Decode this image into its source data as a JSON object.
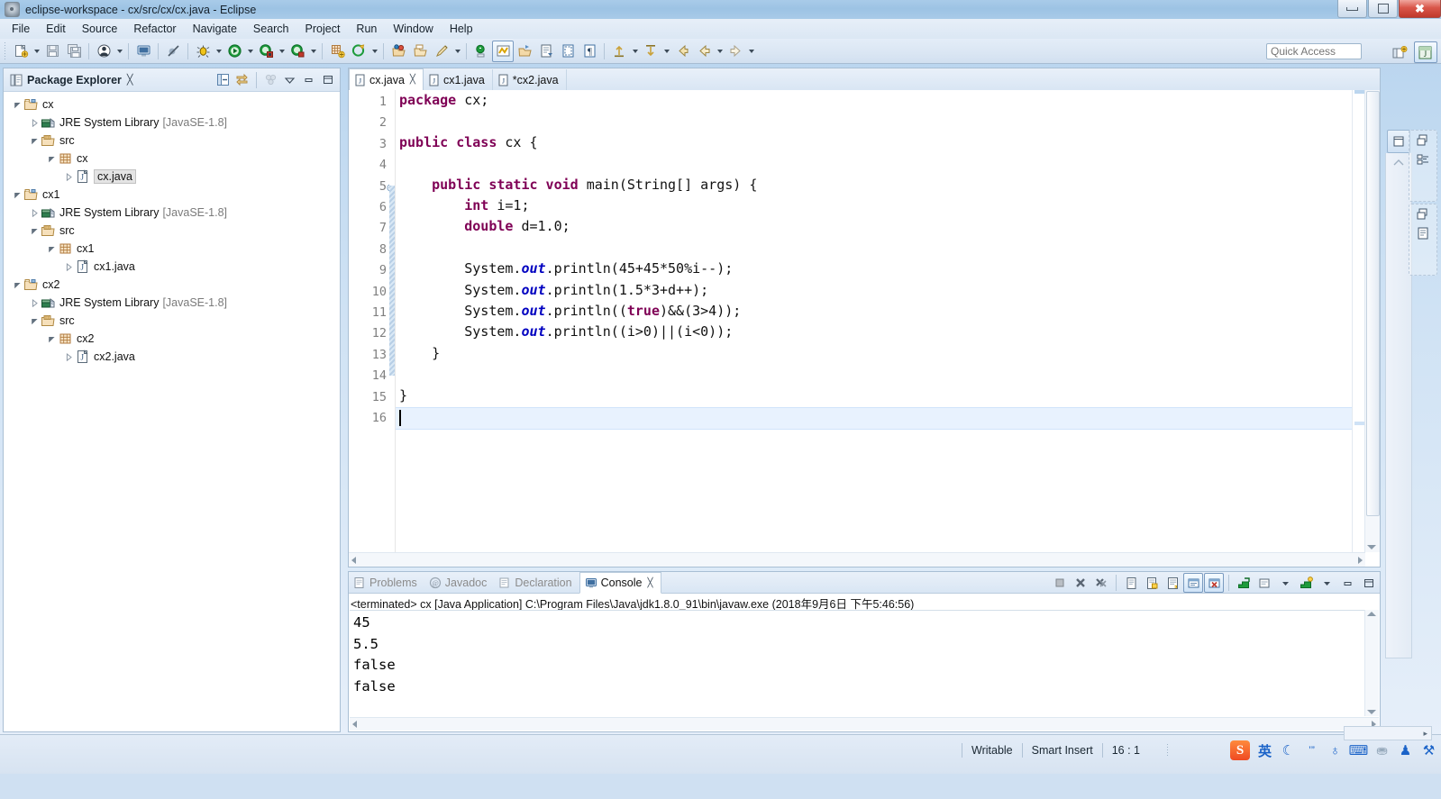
{
  "window": {
    "title": "eclipse-workspace - cx/src/cx/cx.java - Eclipse",
    "app_icon": "eclipse-icon",
    "minimize_label": "Minimize",
    "maximize_label": "Restore",
    "close_label": "Close"
  },
  "menu": {
    "items": [
      {
        "label": "File"
      },
      {
        "label": "Edit"
      },
      {
        "label": "Source"
      },
      {
        "label": "Refactor"
      },
      {
        "label": "Navigate"
      },
      {
        "label": "Search"
      },
      {
        "label": "Project"
      },
      {
        "label": "Run"
      },
      {
        "label": "Window"
      },
      {
        "label": "Help"
      }
    ]
  },
  "toolbar": {
    "quick_access_placeholder": "Quick Access",
    "quick_access_value": "",
    "buttons": [
      {
        "name": "new-wizard",
        "icon": "new-file-icon"
      },
      {
        "name": "save",
        "icon": "save-icon"
      },
      {
        "name": "save-all",
        "icon": "save-all-icon"
      },
      {
        "name": "toggle-breadcrumb",
        "icon": "person-icon"
      },
      {
        "name": "new-java-console",
        "icon": "console-icon"
      },
      {
        "name": "skip-breakpoints",
        "icon": "skip-breakpoints-icon"
      },
      {
        "name": "debug",
        "icon": "debug-bug-icon"
      },
      {
        "name": "run",
        "icon": "run-green-play-icon"
      },
      {
        "name": "coverage",
        "icon": "coverage-icon"
      },
      {
        "name": "run-last-tool",
        "icon": "external-tools-icon"
      },
      {
        "name": "new-java-project",
        "icon": "new-java-project-icon"
      },
      {
        "name": "new-package",
        "icon": "new-package-icon"
      },
      {
        "name": "open-type",
        "icon": "open-type-icon"
      },
      {
        "name": "open-task",
        "icon": "open-task-icon"
      },
      {
        "name": "search",
        "icon": "search-pencil-icon"
      },
      {
        "name": "next-annotation",
        "icon": "next-annotation-icon"
      },
      {
        "name": "toggle-mark-occurrences",
        "icon": "mark-occurrences-icon"
      },
      {
        "name": "restore-last-selection",
        "icon": "restore-selection-icon"
      },
      {
        "name": "open-task-editor",
        "icon": "task-editor-icon"
      },
      {
        "name": "toggle-block-selection",
        "icon": "block-selection-icon"
      },
      {
        "name": "show-whitespace",
        "icon": "pilcrow-icon"
      },
      {
        "name": "previous-edit-location",
        "icon": "prev-edit-icon"
      },
      {
        "name": "next-edit-location",
        "icon": "next-edit-icon"
      },
      {
        "name": "back",
        "icon": "back-arrow-icon"
      },
      {
        "name": "forward",
        "icon": "forward-arrow-icon"
      }
    ],
    "perspective_buttons": [
      {
        "name": "open-perspective",
        "icon": "open-perspective-icon"
      },
      {
        "name": "java-perspective",
        "icon": "java-perspective-icon",
        "active": true
      }
    ]
  },
  "package_explorer": {
    "title": "Package Explorer",
    "close_glyph": "╳",
    "toolbar": [
      {
        "name": "collapse-all",
        "icon": "collapse-all-icon"
      },
      {
        "name": "link-with-editor",
        "icon": "link-editor-icon"
      },
      {
        "name": "focus-on-active-task",
        "icon": "focus-task-icon"
      },
      {
        "name": "view-menu",
        "icon": "view-menu-icon"
      },
      {
        "name": "minimize-view",
        "icon": "minimize-icon"
      },
      {
        "name": "maximize-view",
        "icon": "maximize-icon"
      }
    ],
    "tree": [
      {
        "label": "cx",
        "sub": "",
        "icon": "java-project-icon",
        "indent": 0,
        "state": "expanded",
        "selected": false
      },
      {
        "label": "JRE System Library",
        "sub": "[JavaSE-1.8]",
        "icon": "library-icon",
        "indent": 1,
        "state": "collapsed",
        "selected": false
      },
      {
        "label": "src",
        "sub": "",
        "icon": "source-folder-icon",
        "indent": 1,
        "state": "expanded",
        "selected": false
      },
      {
        "label": "cx",
        "sub": "",
        "icon": "package-icon",
        "indent": 2,
        "state": "expanded",
        "selected": false
      },
      {
        "label": "cx.java",
        "sub": "",
        "icon": "java-file-icon",
        "indent": 3,
        "state": "collapsed",
        "selected": true
      },
      {
        "label": "cx1",
        "sub": "",
        "icon": "java-project-icon",
        "indent": 0,
        "state": "expanded",
        "selected": false
      },
      {
        "label": "JRE System Library",
        "sub": "[JavaSE-1.8]",
        "icon": "library-icon",
        "indent": 1,
        "state": "collapsed",
        "selected": false
      },
      {
        "label": "src",
        "sub": "",
        "icon": "source-folder-icon",
        "indent": 1,
        "state": "expanded",
        "selected": false
      },
      {
        "label": "cx1",
        "sub": "",
        "icon": "package-icon",
        "indent": 2,
        "state": "expanded",
        "selected": false
      },
      {
        "label": "cx1.java",
        "sub": "",
        "icon": "java-file-icon",
        "indent": 3,
        "state": "collapsed",
        "selected": false
      },
      {
        "label": "cx2",
        "sub": "",
        "icon": "java-project-icon",
        "indent": 0,
        "state": "expanded",
        "selected": false
      },
      {
        "label": "JRE System Library",
        "sub": "[JavaSE-1.8]",
        "icon": "library-icon",
        "indent": 1,
        "state": "collapsed",
        "selected": false
      },
      {
        "label": "src",
        "sub": "",
        "icon": "source-folder-icon",
        "indent": 1,
        "state": "expanded",
        "selected": false
      },
      {
        "label": "cx2",
        "sub": "",
        "icon": "package-icon",
        "indent": 2,
        "state": "expanded",
        "selected": false
      },
      {
        "label": "cx2.java",
        "sub": "",
        "icon": "java-file-icon",
        "indent": 3,
        "state": "collapsed",
        "selected": false
      }
    ]
  },
  "editor": {
    "tabs": [
      {
        "label": "cx.java",
        "active": true,
        "dirty": false,
        "close_glyph": "╳"
      },
      {
        "label": "cx1.java",
        "active": false,
        "dirty": false,
        "close_glyph": ""
      },
      {
        "label": "*cx2.java",
        "active": false,
        "dirty": true,
        "close_glyph": ""
      }
    ],
    "line_numbers": [
      "1",
      "2",
      "3",
      "4",
      "5",
      "6",
      "7",
      "8",
      "9",
      "10",
      "11",
      "12",
      "13",
      "14",
      "15",
      "16"
    ],
    "current_line": 16,
    "fold_marker_line": 5,
    "lines": [
      {
        "n": 1,
        "tokens": [
          {
            "t": "package",
            "c": "kw"
          },
          {
            "t": " cx;",
            "c": "pl"
          }
        ]
      },
      {
        "n": 2,
        "tokens": []
      },
      {
        "n": 3,
        "tokens": [
          {
            "t": "public class",
            "c": "kw"
          },
          {
            "t": " cx {",
            "c": "pl"
          }
        ]
      },
      {
        "n": 4,
        "tokens": []
      },
      {
        "n": 5,
        "tokens": [
          {
            "t": "    ",
            "c": "pl"
          },
          {
            "t": "public static void",
            "c": "kw"
          },
          {
            "t": " main(String[] args) {",
            "c": "pl"
          }
        ]
      },
      {
        "n": 6,
        "tokens": [
          {
            "t": "        ",
            "c": "pl"
          },
          {
            "t": "int",
            "c": "kw"
          },
          {
            "t": " i=1;",
            "c": "pl"
          }
        ]
      },
      {
        "n": 7,
        "tokens": [
          {
            "t": "        ",
            "c": "pl"
          },
          {
            "t": "double",
            "c": "kw"
          },
          {
            "t": " d=1.0;",
            "c": "pl"
          }
        ]
      },
      {
        "n": 8,
        "tokens": []
      },
      {
        "n": 9,
        "tokens": [
          {
            "t": "        System.",
            "c": "pl"
          },
          {
            "t": "out",
            "c": "fld"
          },
          {
            "t": ".println(45+45*50%i--);",
            "c": "pl"
          }
        ]
      },
      {
        "n": 10,
        "tokens": [
          {
            "t": "        System.",
            "c": "pl"
          },
          {
            "t": "out",
            "c": "fld"
          },
          {
            "t": ".println(1.5*3+d++);",
            "c": "pl"
          }
        ]
      },
      {
        "n": 11,
        "tokens": [
          {
            "t": "        System.",
            "c": "pl"
          },
          {
            "t": "out",
            "c": "fld"
          },
          {
            "t": ".println((",
            "c": "pl"
          },
          {
            "t": "true",
            "c": "kw"
          },
          {
            "t": ")&&(3>4));",
            "c": "pl"
          }
        ]
      },
      {
        "n": 12,
        "tokens": [
          {
            "t": "        System.",
            "c": "pl"
          },
          {
            "t": "out",
            "c": "fld"
          },
          {
            "t": ".println((i>0)||(i<0));",
            "c": "pl"
          }
        ]
      },
      {
        "n": 13,
        "tokens": [
          {
            "t": "    }",
            "c": "pl"
          }
        ]
      },
      {
        "n": 14,
        "tokens": []
      },
      {
        "n": 15,
        "tokens": [
          {
            "t": "}",
            "c": "pl"
          }
        ]
      },
      {
        "n": 16,
        "tokens": []
      }
    ]
  },
  "console_panel": {
    "tabs": [
      {
        "label": "Problems",
        "icon": "problems-icon",
        "active": false,
        "close_glyph": ""
      },
      {
        "label": "Javadoc",
        "icon": "javadoc-icon",
        "active": false,
        "close_glyph": ""
      },
      {
        "label": "Declaration",
        "icon": "declaration-icon",
        "active": false,
        "close_glyph": ""
      },
      {
        "label": "Console",
        "icon": "console-icon",
        "active": true,
        "close_glyph": "╳"
      }
    ],
    "terminated_line": "<terminated> cx [Java Application] C:\\Program Files\\Java\\jdk1.8.0_91\\bin\\javaw.exe (2018年9月6日 下午5:46:56)",
    "output_lines": [
      "45",
      "5.5",
      "false",
      "false"
    ],
    "toolbar": [
      {
        "name": "terminate",
        "icon": "terminate-icon"
      },
      {
        "name": "remove-launch",
        "icon": "remove-launch-icon"
      },
      {
        "name": "remove-all-terminated",
        "icon": "remove-all-icon"
      },
      {
        "name": "clear-console",
        "icon": "clear-console-icon"
      },
      {
        "name": "scroll-lock",
        "icon": "scroll-lock-icon"
      },
      {
        "name": "word-wrap",
        "icon": "word-wrap-icon"
      },
      {
        "name": "pin-console",
        "icon": "pin-console-icon",
        "active": true
      },
      {
        "name": "display-selected-console",
        "icon": "display-console-icon",
        "active": true
      },
      {
        "name": "open-console",
        "icon": "open-console-icon"
      },
      {
        "name": "new-console-view",
        "icon": "new-console-view-icon"
      },
      {
        "name": "view-menu",
        "icon": "view-menu-icon"
      },
      {
        "name": "minimize-view",
        "icon": "minimize-icon"
      },
      {
        "name": "maximize-view",
        "icon": "maximize-icon"
      }
    ]
  },
  "fast_view_bar": {
    "buttons": [
      {
        "name": "restore-view",
        "icon": "restore-icon"
      },
      {
        "name": "outline-view",
        "icon": "outline-icon"
      },
      {
        "name": "task-list-view",
        "icon": "task-list-icon"
      },
      {
        "name": "problems-view",
        "icon": "problems-view-icon"
      },
      {
        "name": "properties-view",
        "icon": "properties-icon"
      }
    ]
  },
  "status_bar": {
    "writable": "Writable",
    "insert_mode": "Smart Insert",
    "position": "16 : 1",
    "tray": [
      {
        "name": "sogou-input-icon",
        "glyph": "S"
      },
      {
        "name": "language-mode-icon",
        "glyph": "英"
      },
      {
        "name": "moon-icon",
        "glyph": "☾"
      },
      {
        "name": "punctuation-icon",
        "glyph": "’”"
      },
      {
        "name": "microphone-icon",
        "glyph": "♁"
      },
      {
        "name": "soft-keyboard-icon",
        "glyph": "⌨"
      },
      {
        "name": "user-icon",
        "glyph": "⛂"
      },
      {
        "name": "skin-icon",
        "glyph": "♟"
      },
      {
        "name": "toolbox-icon",
        "glyph": "⚒"
      }
    ]
  }
}
